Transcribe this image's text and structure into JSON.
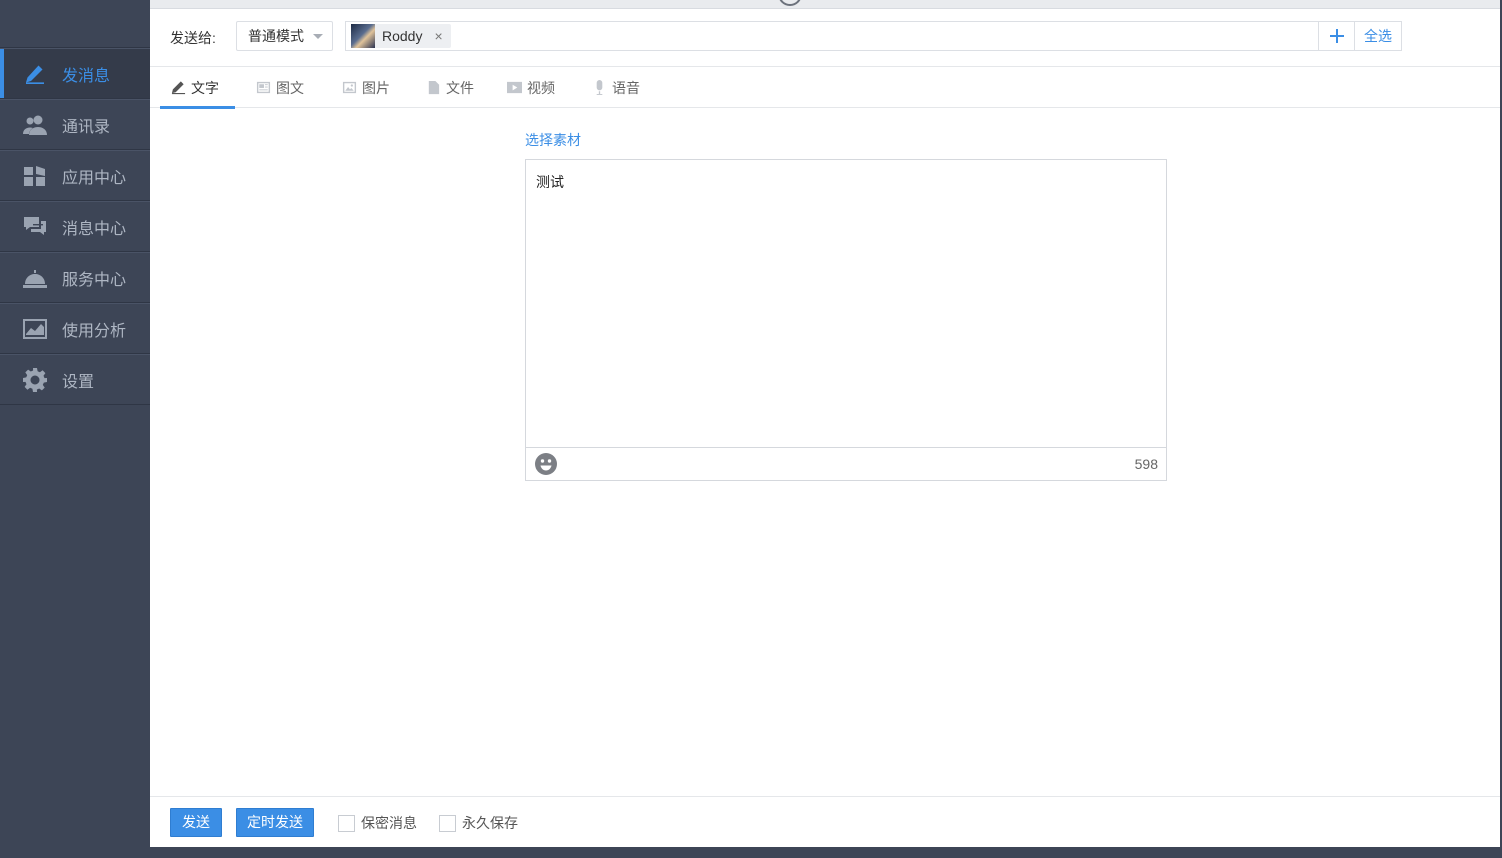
{
  "sidebar": {
    "items": [
      {
        "label": "发消息",
        "icon": "pencil-icon",
        "active": true
      },
      {
        "label": "通讯录",
        "icon": "contacts-icon",
        "active": false
      },
      {
        "label": "应用中心",
        "icon": "apps-grid-icon",
        "active": false
      },
      {
        "label": "消息中心",
        "icon": "chat-bubbles-icon",
        "active": false
      },
      {
        "label": "服务中心",
        "icon": "service-bell-icon",
        "active": false
      },
      {
        "label": "使用分析",
        "icon": "line-chart-icon",
        "active": false
      },
      {
        "label": "设置",
        "icon": "gear-icon",
        "active": false
      }
    ]
  },
  "compose": {
    "send_to_label": "发送给:",
    "mode_selected": "普通模式",
    "recipients": [
      {
        "name": "Roddy",
        "remove": "×"
      }
    ],
    "add_icon": "plus-icon",
    "select_all": "全选"
  },
  "tabs": [
    {
      "label": "文字",
      "icon": "pencil-icon",
      "active": true
    },
    {
      "label": "图文",
      "icon": "article-icon",
      "active": false
    },
    {
      "label": "图片",
      "icon": "image-icon",
      "active": false
    },
    {
      "label": "文件",
      "icon": "file-icon",
      "active": false
    },
    {
      "label": "视频",
      "icon": "video-icon",
      "active": false
    },
    {
      "label": "语音",
      "icon": "microphone-icon",
      "active": false
    }
  ],
  "editor": {
    "choose_material": "选择素材",
    "content": "测试",
    "emoji_icon": "smiley-icon",
    "remaining_chars": "598"
  },
  "footer": {
    "send": "发送",
    "scheduled_send": "定时发送",
    "secret_message": "保密消息",
    "keep_forever": "永久保存"
  },
  "colors": {
    "accent": "#3b8ee5",
    "sidebar_bg": "#3d4556"
  }
}
